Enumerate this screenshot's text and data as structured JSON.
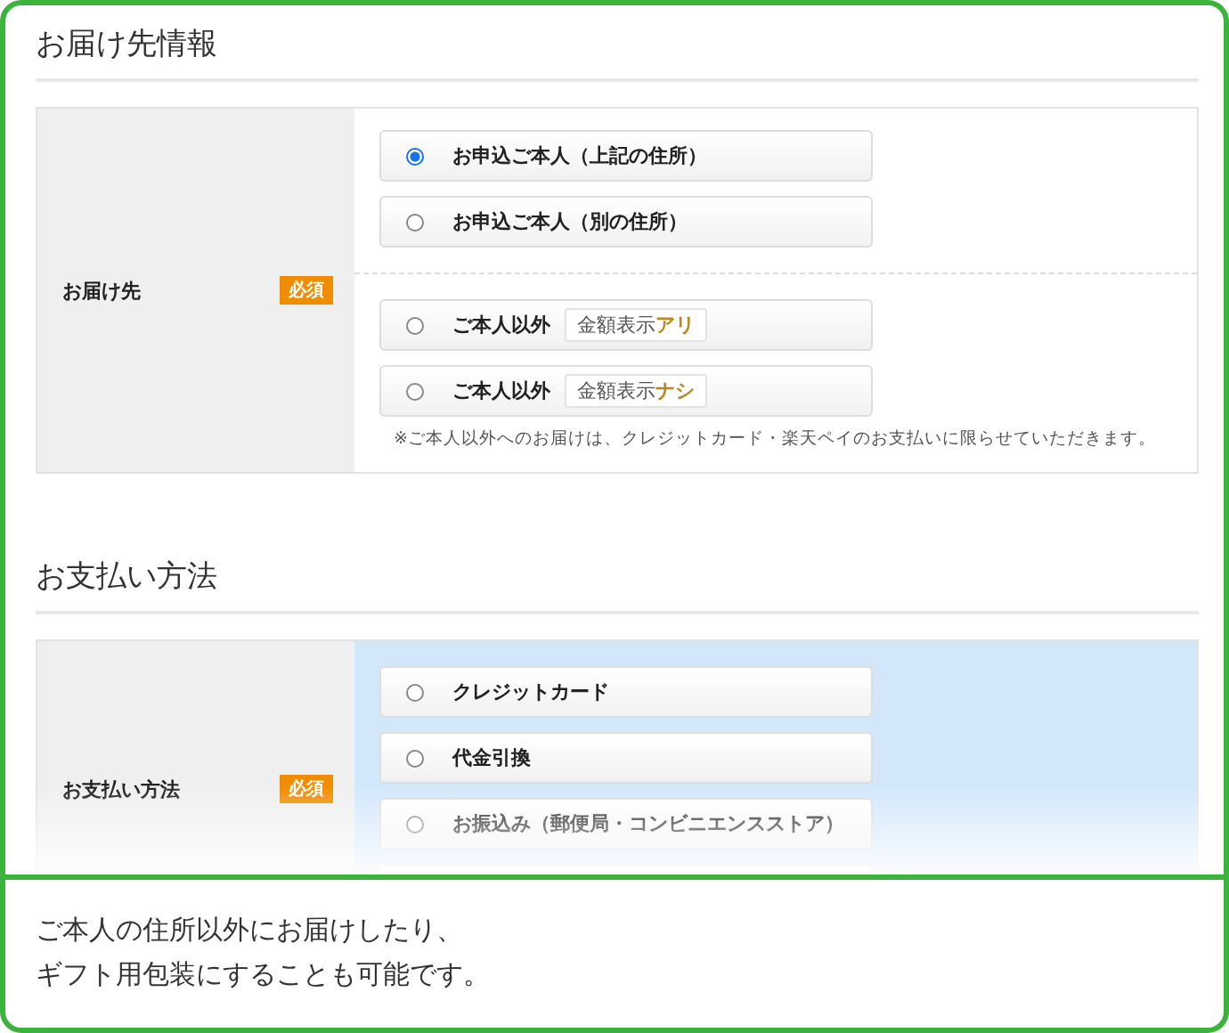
{
  "delivery_section": {
    "title": "お届け先情報",
    "field_label": "お届け先",
    "required_badge": "必須",
    "option_groups": [
      [
        {
          "label": "お申込ご本人（上記の住所）",
          "selected": true
        },
        {
          "label": "お申込ご本人（別の住所）",
          "selected": false
        }
      ],
      [
        {
          "label": "ご本人以外",
          "selected": false,
          "tag": {
            "text": "金額表示",
            "emphasis": "アリ"
          }
        },
        {
          "label": "ご本人以外",
          "selected": false,
          "tag": {
            "text": "金額表示",
            "emphasis": "ナシ"
          }
        }
      ]
    ],
    "note": "※ご本人以外へのお届けは、クレジットカード・楽天ペイのお支払いに限らせていただきます。"
  },
  "payment_section": {
    "title": "お支払い方法",
    "field_label": "お支払い方法",
    "required_badge": "必須",
    "options": [
      {
        "label": "クレジットカード",
        "selected": false
      },
      {
        "label": "代金引換",
        "selected": false
      },
      {
        "label": "お振込み（郵便局・コンビニエンスストア）",
        "selected": false
      }
    ]
  },
  "caption": {
    "lines": [
      "ご本人の住所以外にお届けしたり、",
      "ギフト用包装にすることも可能です。"
    ]
  }
}
